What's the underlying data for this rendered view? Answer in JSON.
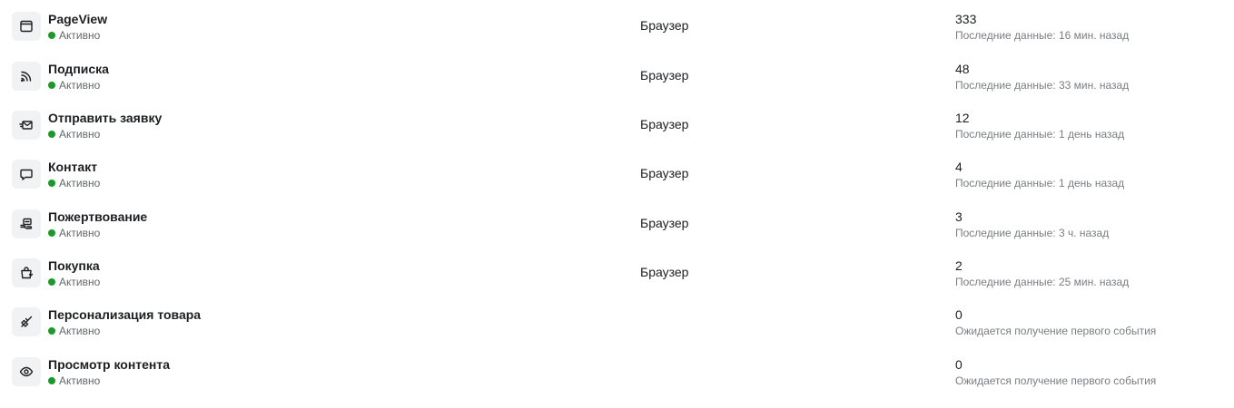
{
  "events": [
    {
      "icon": "browser-window-icon",
      "name": "PageView",
      "status": "Активно",
      "source": "Браузер",
      "count": "333",
      "last_data": "Последние данные: 16 мин. назад"
    },
    {
      "icon": "rss-feed-icon",
      "name": "Подписка",
      "status": "Активно",
      "source": "Браузер",
      "count": "48",
      "last_data": "Последние данные: 33 мин. назад"
    },
    {
      "icon": "send-envelope-icon",
      "name": "Отправить заявку",
      "status": "Активно",
      "source": "Браузер",
      "count": "12",
      "last_data": "Последние данные: 1 день назад"
    },
    {
      "icon": "chat-bubble-icon",
      "name": "Контакт",
      "status": "Активно",
      "source": "Браузер",
      "count": "4",
      "last_data": "Последние данные: 1 день назад"
    },
    {
      "icon": "donation-icon",
      "name": "Пожертвование",
      "status": "Активно",
      "source": "Браузер",
      "count": "3",
      "last_data": "Последние данные: 3 ч. назад"
    },
    {
      "icon": "shopping-bag-icon",
      "name": "Покупка",
      "status": "Активно",
      "source": "Браузер",
      "count": "2",
      "last_data": "Последние данные: 25 мин. назад"
    },
    {
      "icon": "paint-brush-icon",
      "name": "Персонализация товара",
      "status": "Активно",
      "source": "",
      "count": "0",
      "last_data": "Ожидается получение первого события"
    },
    {
      "icon": "eye-icon",
      "name": "Просмотр контента",
      "status": "Активно",
      "source": "",
      "count": "0",
      "last_data": "Ожидается получение первого события"
    }
  ],
  "colors": {
    "status_active": "#1b9a2b",
    "icon_background": "#f1f2f4",
    "secondary_text": "#7a7d82"
  }
}
